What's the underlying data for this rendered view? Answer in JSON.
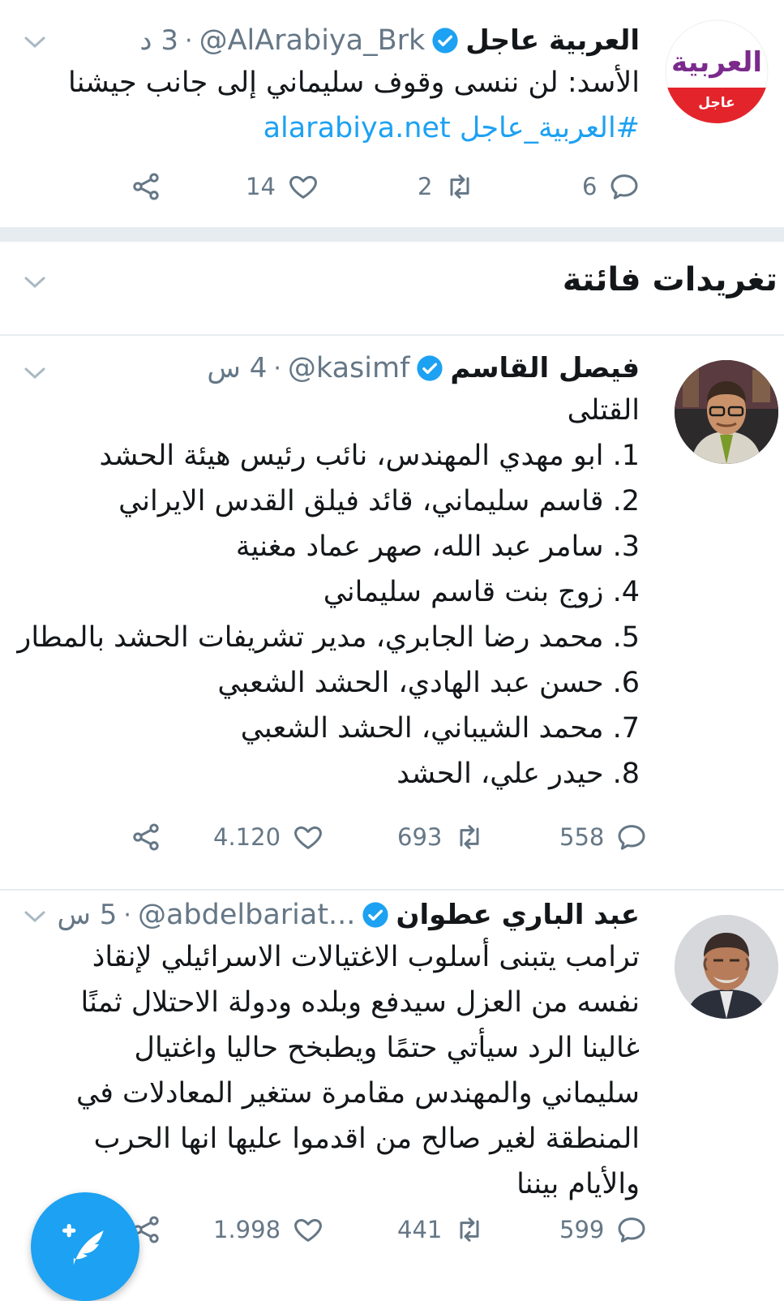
{
  "tweet1": {
    "name": "العربية عاجل",
    "handle": "@AlArabiya_Brk",
    "time": "3 د",
    "text": "الأسد: لن ننسى وقوف سليماني إلى جانب جيشنا",
    "hashtag": "#العربية_عاجل",
    "link": "alarabiya.net",
    "avatar_logo": "العربية",
    "avatar_badge": "عاجل",
    "replies": "6",
    "retweets": "2",
    "likes": "14"
  },
  "section": {
    "title": "تغريدات فائتة"
  },
  "tweet2": {
    "name": "فيصل القاسم",
    "handle": "@kasimf",
    "time": "4 س",
    "lines": [
      "القتلى",
      "1. ابو مهدي المهندس، نائب رئيس هيئة الحشد",
      "2. قاسم سليماني، قائد فيلق القدس الايراني",
      "3. سامر عبد الله، صهر عماد مغنية",
      "4. زوج بنت قاسم سليماني",
      "5. محمد رضا الجابري، مدير تشريفات الحشد بالمطار",
      "6. حسن عبد الهادي، الحشد الشعبي",
      "7. محمد الشيباني، الحشد الشعبي",
      "8. حيدر علي، الحشد"
    ],
    "replies": "558",
    "retweets": "693",
    "likes": "4.120"
  },
  "tweet3": {
    "name": "عبد الباري عطوان",
    "handle": "@abdelbariat...",
    "time": "5 س",
    "lines": [
      "ترامب يتبنى أسلوب الاغتيالات الاسرائيلي لإنقاذ",
      "نفسه من العزل سيدفع وبلده ودولة الاحتلال ثمنًا",
      "غالينا الرد سيأتي حتمًا ويطبخح حاليا واغتيال",
      "سليماني والمهندس مقامرة ستغير المعادلات في",
      "المنطقة لغير صالح من اقدموا عليها انها الحرب",
      "والأيام بيننا"
    ],
    "replies": "599",
    "retweets": "441",
    "likes": "1.998"
  },
  "colors": {
    "accent": "#1da1f2",
    "muted": "#657786",
    "divider": "#e6ecf0",
    "arabiya_purple": "#7b2a8c",
    "arabiya_red": "#e4242b"
  },
  "icons": [
    "verified-badge-icon",
    "chevron-down-icon",
    "reply-icon",
    "retweet-icon",
    "like-icon",
    "share-icon",
    "compose-tweet-icon"
  ]
}
